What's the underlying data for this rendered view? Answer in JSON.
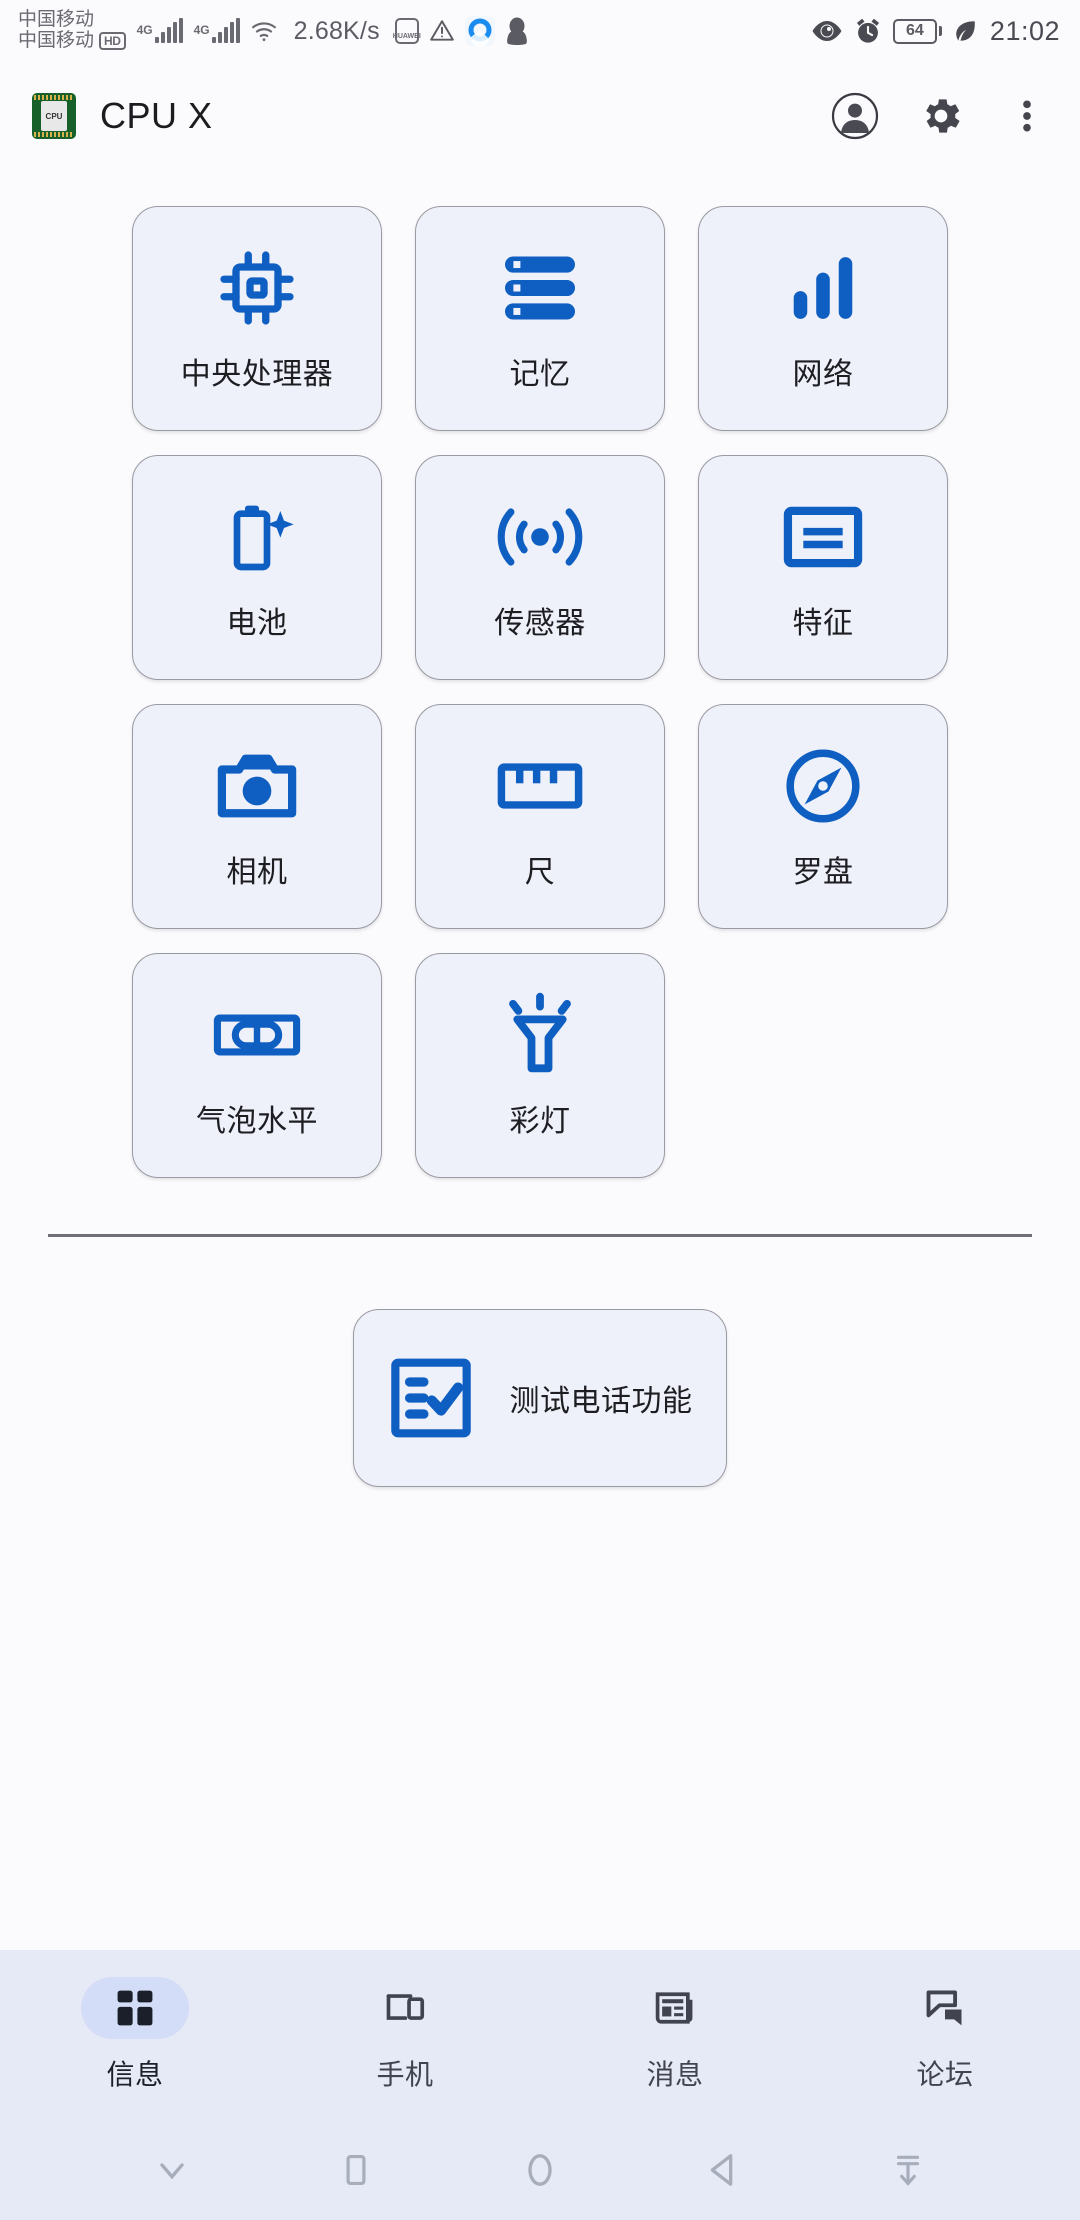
{
  "status_bar": {
    "carrier_line1": "中国移动",
    "carrier_line2": "中国移动",
    "hd_badge": "HD",
    "signal1_label": "4G",
    "signal2_label": "4G",
    "network_speed": "2.68K/s",
    "huawei_label": "HUAWEI",
    "battery_level": "64",
    "time": "21:02"
  },
  "app_bar": {
    "logo_text": "CPU",
    "title": "CPU X"
  },
  "tiles": [
    {
      "label": "中央处理器",
      "icon": "cpu-icon"
    },
    {
      "label": "记忆",
      "icon": "memory-icon"
    },
    {
      "label": "网络",
      "icon": "network-bars-icon"
    },
    {
      "label": "电池",
      "icon": "battery-icon"
    },
    {
      "label": "传感器",
      "icon": "sensor-icon"
    },
    {
      "label": "特征",
      "icon": "features-icon"
    },
    {
      "label": "相机",
      "icon": "camera-icon"
    },
    {
      "label": "尺",
      "icon": "ruler-icon"
    },
    {
      "label": "罗盘",
      "icon": "compass-icon"
    },
    {
      "label": "气泡水平",
      "icon": "bubble-level-icon"
    },
    {
      "label": "彩灯",
      "icon": "flashlight-icon"
    }
  ],
  "test_button": {
    "label": "测试电话功能",
    "icon": "checklist-icon"
  },
  "bottom_nav": [
    {
      "label": "信息",
      "icon": "dashboard-icon",
      "active": true
    },
    {
      "label": "手机",
      "icon": "devices-icon",
      "active": false
    },
    {
      "label": "消息",
      "icon": "news-icon",
      "active": false
    },
    {
      "label": "论坛",
      "icon": "forum-icon",
      "active": false
    }
  ],
  "system_nav": [
    {
      "icon": "chevron-down-icon"
    },
    {
      "icon": "recents-icon"
    },
    {
      "icon": "home-icon"
    },
    {
      "icon": "back-icon"
    },
    {
      "icon": "download-icon"
    }
  ],
  "colors": {
    "accent_blue": "#0f5fc2",
    "tile_bg": "#eef1f9",
    "nav_bg": "#e6eaf6",
    "pill_active": "#d4ddf7"
  }
}
